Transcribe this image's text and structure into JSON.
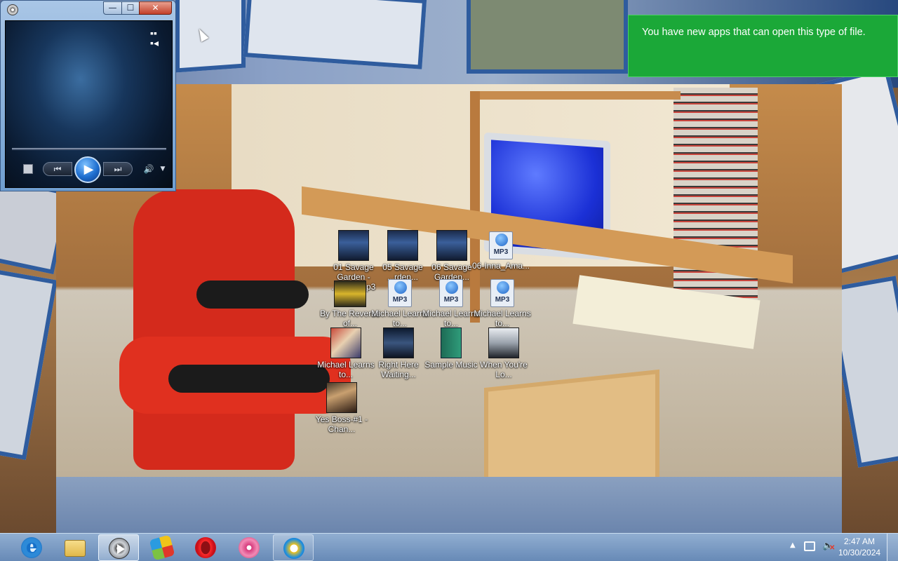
{
  "notification": {
    "text": "You have new apps that can open this type of file."
  },
  "media_player": {
    "window_buttons": {
      "minimize": "—",
      "maximize": "☐",
      "close": "✕"
    },
    "controls": {
      "switch_view_icon": "switch-to-library-icon",
      "stop_icon": "stop-icon",
      "previous_symbol": "⏮",
      "play_symbol": "▶",
      "next_symbol": "⏭",
      "volume_symbol": "🔊",
      "volume_dropdown_symbol": "▼"
    }
  },
  "desktop_icons": [
    {
      "label": "01 Savage Garden - ...ation.mp3",
      "type": "album-cover"
    },
    {
      "label": "05 Savage ...rden...",
      "type": "album-cover"
    },
    {
      "label": "06 Savage Garden...",
      "type": "album-cover"
    },
    {
      "label": "06-Inna_Ama...",
      "type": "mp3-file",
      "badge": "MP3"
    },
    {
      "label": "By The Reverse of...",
      "type": "album-cover"
    },
    {
      "label": "Michael Learns to...",
      "type": "mp3-file",
      "badge": "MP3"
    },
    {
      "label": "Michael Learns to...",
      "type": "mp3-file",
      "badge": "MP3"
    },
    {
      "label": "Michael Learns to...",
      "type": "mp3-file",
      "badge": "MP3"
    },
    {
      "label": "Michael Learns to...",
      "type": "album-cover"
    },
    {
      "label": "Right Here Waiting...",
      "type": "album-cover"
    },
    {
      "label": "Sample Music",
      "type": "folder"
    },
    {
      "label": "When You're Lo...",
      "type": "album-cover"
    },
    {
      "label": "Yes Boss-#1 - Chan...",
      "type": "album-cover"
    }
  ],
  "taskbar": {
    "pinned": [
      {
        "name": "internet-explorer",
        "state": "pinned"
      },
      {
        "name": "windows-explorer",
        "state": "pinned"
      },
      {
        "name": "windows-media-player",
        "state": "active"
      },
      {
        "name": "bluestacks",
        "state": "pinned"
      },
      {
        "name": "opera",
        "state": "pinned"
      },
      {
        "name": "flower-app",
        "state": "pinned"
      },
      {
        "name": "screen-recorder",
        "state": "open"
      }
    ],
    "tray": {
      "show_hidden_symbol": "▲",
      "volume_muted": true
    },
    "clock": {
      "time": "2:47 AM",
      "date": "10/30/2024"
    }
  },
  "colors": {
    "toast_background": "#1ba838",
    "taskbar": "#7fa3cc",
    "player_accent": "#1f6fd0"
  }
}
